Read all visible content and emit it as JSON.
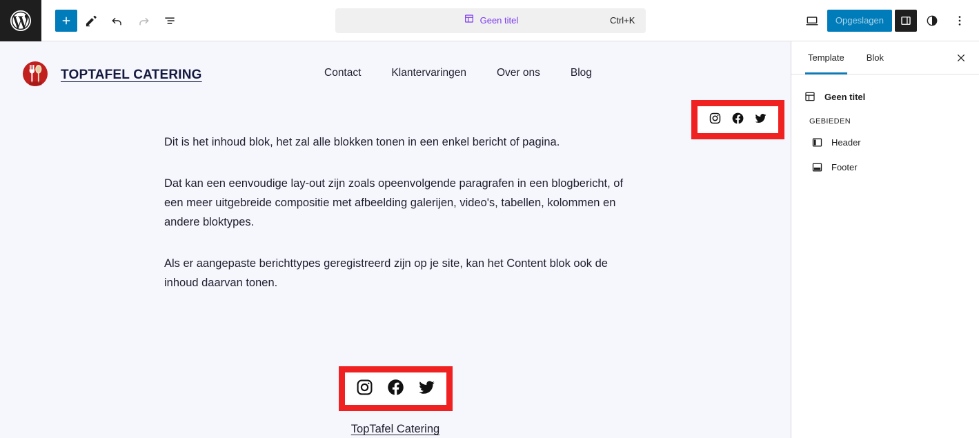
{
  "toolbar": {
    "wp_logo": "wordpress-logo",
    "add_block_label": "+",
    "edit_tool": "edit-pencil",
    "undo_label": "undo",
    "redo_label": "redo",
    "list_view_label": "list-view",
    "command_bar": {
      "title": "Geen titel",
      "shortcut": "Ctrl+K",
      "icon": "template-icon"
    },
    "view_label": "view-desktop",
    "save_label": "Opgeslagen",
    "settings_toggle_label": "settings-sidebar",
    "styles_label": "styles-contrast",
    "options_label": "more-options"
  },
  "site": {
    "title": "TOPTAFEL CATERING",
    "nav": [
      {
        "label": "Contact"
      },
      {
        "label": "Klantervaringen"
      },
      {
        "label": "Over ons"
      },
      {
        "label": "Blog"
      }
    ],
    "social": [
      {
        "name": "instagram-icon"
      },
      {
        "name": "facebook-icon"
      },
      {
        "name": "twitter-icon"
      }
    ],
    "content_paragraphs": [
      "Dit is het inhoud blok, het zal alle blokken tonen in een enkel bericht of pagina.",
      "Dat kan een eenvoudige lay-out zijn zoals opeenvolgende paragrafen in een blogbericht, of een meer uitgebreide compositie met afbeelding galerijen, video's, tabellen, kolommen en andere bloktypes.",
      "Als er aangepaste berichttypes geregistreerd zijn op je site, kan het Content blok ook de inhoud daarvan tonen."
    ],
    "footer_link": "TopTafel Catering"
  },
  "sidebar": {
    "tabs": [
      {
        "label": "Template",
        "active": true
      },
      {
        "label": "Blok",
        "active": false
      }
    ],
    "close_label": "close-panel",
    "template_name": "Geen titel",
    "areas_label": "GEBIEDEN",
    "areas": [
      {
        "label": "Header",
        "icon": "header-area-icon"
      },
      {
        "label": "Footer",
        "icon": "footer-area-icon"
      }
    ]
  },
  "colors": {
    "accent_blue": "#007cba",
    "command_purple": "#7c3aed",
    "annotation_red": "#f02121",
    "canvas_bg": "#f6f7fd",
    "logo_red": "#c2201f",
    "title_navy": "#14183e"
  }
}
